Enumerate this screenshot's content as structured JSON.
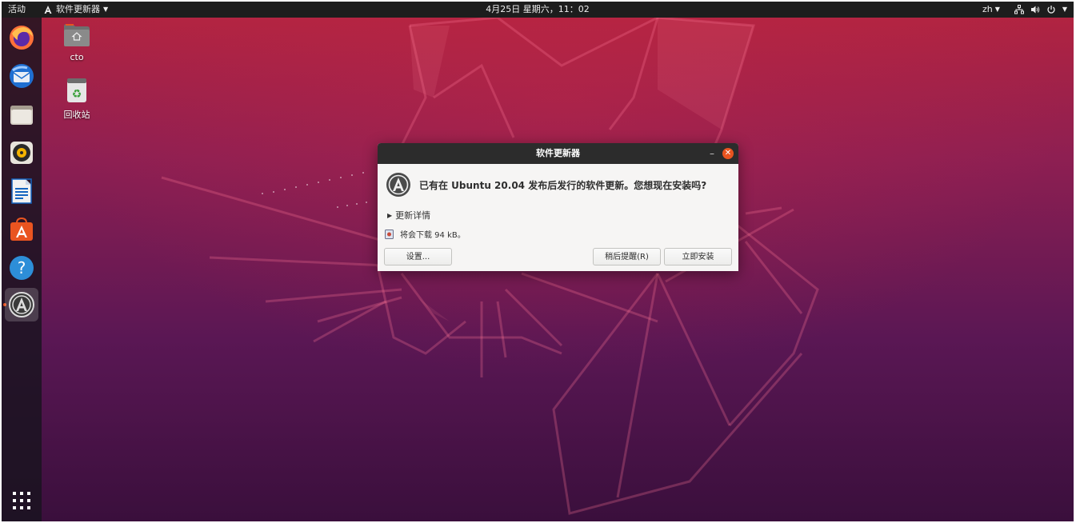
{
  "topbar": {
    "activities": "活动",
    "app_menu": "软件更新器",
    "clock": "4月25日 星期六，11：02",
    "lang": "zh"
  },
  "dock": {
    "items": [
      {
        "name": "firefox-icon"
      },
      {
        "name": "thunderbird-icon"
      },
      {
        "name": "files-icon"
      },
      {
        "name": "rhythmbox-icon"
      },
      {
        "name": "libreoffice-writer-icon"
      },
      {
        "name": "ubuntu-software-icon"
      },
      {
        "name": "help-icon"
      },
      {
        "name": "software-updater-icon"
      }
    ],
    "apps_grid_icon": "show-apps-icon"
  },
  "desktop": {
    "home_label": "cto",
    "trash_label": "回收站"
  },
  "dialog": {
    "title": "软件更新器",
    "message": "已有在 Ubuntu 20.04 发布后发行的软件更新。您想现在安装吗?",
    "details_label": "更新详情",
    "download_text": "将会下载 94 kB。",
    "settings_button": "设置...",
    "remind_button": "稍后提醒(R)",
    "install_button": "立即安装"
  },
  "colors": {
    "accent": "#e95420",
    "topbar": "#1d1d1d",
    "titlebar": "#2c2c2c"
  }
}
